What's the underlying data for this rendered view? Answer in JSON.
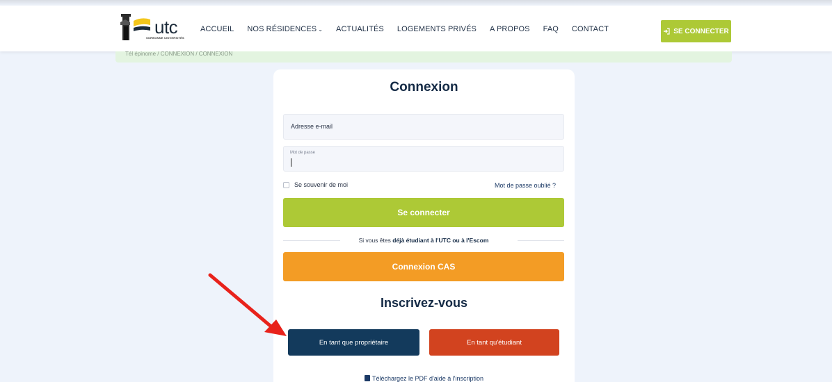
{
  "header": {
    "logo_text": "utc",
    "logo_sub": "SORBONNE UNIVERSITÉS",
    "nav": [
      {
        "label": "ACCUEIL"
      },
      {
        "label": "NOS RÉSIDENCES"
      },
      {
        "label": "ACTUALITÉS"
      },
      {
        "label": "LOGEMENTS PRIVÉS"
      },
      {
        "label": "A PROPOS"
      },
      {
        "label": "FAQ"
      },
      {
        "label": "CONTACT"
      }
    ],
    "login_label": "SE CONNECTER"
  },
  "breadcrumb": "Tél épinome / CONNEXION / CONNEXION",
  "login_card": {
    "title": "Connexion",
    "email_label": "Adresse e-mail",
    "password_label": "Mot de passe",
    "remember_label": "Se souvenir de moi",
    "forgot_label": "Mot de passe oublié ?",
    "connect_label": "Se connecter",
    "divider_prefix": "Si vous êtes ",
    "divider_bold": "déjà étudiant à l'UTC ou à l'Escom",
    "cas_label": "Connexion CAS",
    "register_title": "Inscrivez-vous",
    "owner_label": "En tant que propriétaire",
    "student_label": "En tant qu'étudiant",
    "pdf_label": "Téléchargez le PDF d'aide à l'inscription"
  },
  "colors": {
    "green": "#adc936",
    "orange": "#f39c25",
    "navy": "#133a5c",
    "red": "#d2431f",
    "arrow": "#e8221b"
  }
}
